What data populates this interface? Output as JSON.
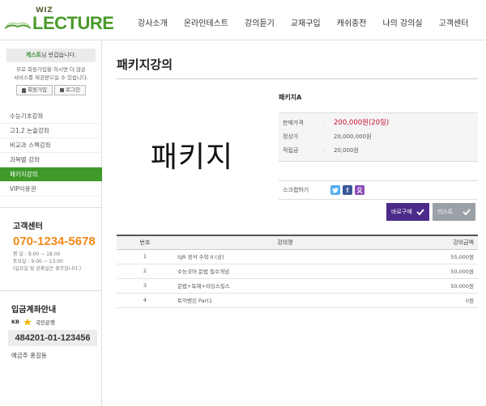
{
  "brand": {
    "top": "WIZ",
    "main": "LECTURE"
  },
  "gnb": [
    "강사소개",
    "온라인테스트",
    "강의듣기",
    "교재구입",
    "캐쉬충전",
    "나의 강의실",
    "고객센터"
  ],
  "login": {
    "guest": "게스트",
    "greeting": "님 반갑습니다.",
    "desc1": "무료 회원가입을 하시면 더 많은",
    "desc2": "서비스를 제공받으실 수 있습니다.",
    "join_label": "회원가입",
    "login_label": "로그인"
  },
  "lnb": [
    "수능기초강좌",
    "고1,2 논술강좌",
    "비교과 스펙강좌",
    "과목별 강좌",
    "패키지강의",
    "VIP이용권"
  ],
  "lnb_active_index": 4,
  "cs": {
    "title": "고객센터",
    "phone": "070-1234-5678",
    "hours1": "평 일 : 9:00 ~ 18:00",
    "hours2": "토요일 : 9:00 ~ 13:00",
    "note": "(일요일 및 공휴일은 휴무입니다.)"
  },
  "bank": {
    "title": "입금계좌안내",
    "kb": "KB",
    "bank_name": "국민은행",
    "account": "484201-01-123456",
    "holder": "예금주 홍길동"
  },
  "main": {
    "title": "패키지강의",
    "thumb_text": "패키지",
    "product_name": "패키지A",
    "rows": [
      {
        "label": "판매가격",
        "value": "200,000원(20일)"
      },
      {
        "label": "정상가",
        "value": "20,000,000원"
      },
      {
        "label": "적립금",
        "value": "20,000원"
      }
    ],
    "scrap_label": "스크랩하기",
    "buy_label": "바로구매",
    "list_label": "리스트"
  },
  "table": {
    "headers": [
      "번호",
      "강의명",
      "강의금액"
    ],
    "rows": [
      {
        "no": "1",
        "name": "SJR 정석 수학 II (상)",
        "price": "55,000원"
      },
      {
        "no": "2",
        "name": "수능국어 문법 필수개념",
        "price": "50,000원"
      },
      {
        "no": "3",
        "name": "문법+독해+리딩스킬스",
        "price": "50,000원"
      },
      {
        "no": "4",
        "name": "토익벤진 Part1",
        "price": "0원"
      }
    ]
  },
  "colors": {
    "brand_green": "#3f9a2a",
    "phone_orange": "#f08a1a",
    "price_red": "#c8102e",
    "buy_purple": "#4b2a8a"
  },
  "icons": [
    "book-logo-icon",
    "user-icon",
    "lock-icon",
    "kb-star-icon",
    "twitter-icon",
    "facebook-icon",
    "myspace-icon",
    "check-icon"
  ]
}
